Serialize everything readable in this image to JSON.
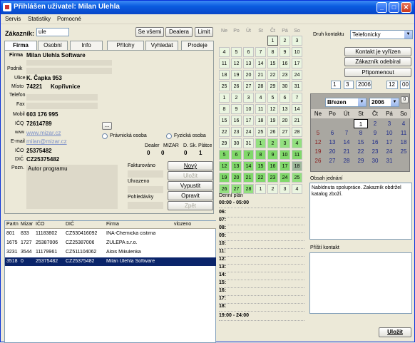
{
  "app": {
    "title": "Přihlášen uživatel: Milan Ulehla",
    "menu": [
      "Servis",
      "Statistiky",
      "Pomocné"
    ]
  },
  "search": {
    "label": "Zákazník:",
    "value": "ule",
    "btn_all": "Se všemi",
    "btn_dealer": "Dealera",
    "btn_limit": "Limit"
  },
  "tabs": [
    "Firma",
    "Osobní",
    "Info",
    "Přílohy",
    "Vyhledat",
    "Prodeje"
  ],
  "company": {
    "firma_label": "Firma",
    "firma": "Milan Ulehla Software",
    "podnik_label": "Podnik",
    "ulice_label": "Ulice",
    "ulice": "K. Čapka 953",
    "misto_label": "Místo",
    "psc": "74221",
    "misto": "Kopřivnice",
    "telefon_label": "Telefon",
    "fax_label": "Fax",
    "mobil_label": "Mobil",
    "mobil": "603 176 995",
    "ico_label": "IČQ",
    "ico": "72614789",
    "www_label": "www",
    "www": "www.mizar.cz",
    "email_label": "E-mail",
    "email": "milan@mizar.cz",
    "ic_label": "IČO",
    "ic": "25375482",
    "dic_label": "DIČ",
    "dic": "CZ25375482",
    "pozn_label": "Pozn.",
    "pozn": "Autor programu",
    "radio_pravnicka": "Právnická osoba",
    "radio_fyzicka": "Fyzická osoba",
    "dealer_label": "Dealer",
    "dealer": "0",
    "mizar_label": "MIZAR",
    "mizar": "0",
    "dsk_label": "D. Sk.",
    "dsk": "0",
    "platce_label": "Plátce",
    "platce": "1",
    "fakturovano": "Fakturováno",
    "uhrazeno": "Uhrazeno",
    "pohledavky": "Pohledávky",
    "btn_novy": "Nový",
    "btn_ulozit": "Uložit",
    "btn_vypustit": "Vypustit",
    "btn_opravit": "Opravit",
    "btn_zpet": "Zpět"
  },
  "table": {
    "headers": [
      "Partn",
      "Mizar",
      "IČO",
      "DIČ",
      "Firma",
      "vlozeno"
    ],
    "rows": [
      [
        "801",
        "833",
        "11183802",
        "CZ530416092",
        "INA-Chemicka cistirna",
        ""
      ],
      [
        "1675",
        "1727",
        "25387006",
        "CZ25387006",
        "ZULEPA s.r.o.",
        ""
      ],
      [
        "3231",
        "3544",
        "11179961",
        "CZ511104062",
        "Alois Mikulenka",
        ""
      ],
      [
        "3518",
        "0",
        "25375482",
        "CZ25375482",
        "Milan Ulehla Software",
        ""
      ]
    ]
  },
  "calendar": {
    "days": [
      "Ne",
      "Po",
      "Út",
      "St",
      "Čt",
      "Pá",
      "So"
    ],
    "rows": [
      [
        "",
        "",
        "",
        "",
        "1",
        "2",
        "3"
      ],
      [
        "4",
        "5",
        "6",
        "7",
        "8",
        "9",
        "10"
      ],
      [
        "11",
        "12",
        "13",
        "14",
        "15",
        "16",
        "17"
      ],
      [
        "18",
        "19",
        "20",
        "21",
        "22",
        "23",
        "24"
      ],
      [
        "25",
        "26",
        "27",
        "28",
        "29",
        "30",
        "31"
      ],
      [
        "1",
        "2",
        "3",
        "4",
        "5",
        "6",
        "7"
      ],
      [
        "8",
        "9",
        "10",
        "11",
        "12",
        "13",
        "14"
      ],
      [
        "15",
        "16",
        "17",
        "18",
        "19",
        "20",
        "21"
      ],
      [
        "22",
        "23",
        "24",
        "25",
        "26",
        "27",
        "28"
      ],
      [
        "29",
        "30",
        "31",
        "1",
        "2",
        "3",
        "4"
      ],
      [
        "5",
        "6",
        "7",
        "8",
        "9",
        "10",
        "11"
      ],
      [
        "12",
        "13",
        "14",
        "15",
        "16",
        "17",
        "18"
      ],
      [
        "19",
        "20",
        "21",
        "22",
        "23",
        "24",
        "25"
      ],
      [
        "26",
        "27",
        "28",
        "1",
        "2",
        "3",
        "4"
      ]
    ]
  },
  "schedule": {
    "title": "Denní plán",
    "start": "00:00 - 05:00",
    "hours": [
      "06:",
      "07:",
      "08:",
      "09:",
      "10:",
      "11:",
      "12:",
      "13:",
      "14:",
      "15:",
      "16:",
      "17:",
      "18:"
    ],
    "end": "19:00 - 24:00"
  },
  "contact": {
    "druh_label": "Druh kontaktu",
    "druh": "Telefonicky",
    "btn_vyrizen": "Kontakt je vyřízen",
    "btn_odebiral": "Zákazník odebíral",
    "btn_pripomenout": "Připomenout",
    "date_d": "1",
    "date_m": "3",
    "date_y": "2006",
    "time_h": "12",
    "time_m": "00",
    "obsah_label": "Obsah jednání",
    "obsah": "Nabídnuta spolupráce. Zakazník obdržel katalog zboží.",
    "pristi_label": "Příští kontakt",
    "btn_ulozit": "Uložit"
  },
  "minical": {
    "month": "Březen",
    "year": "2006",
    "days": [
      "Ne",
      "Po",
      "Út",
      "St",
      "Čt",
      "Pá",
      "So"
    ],
    "rows": [
      [
        "",
        "",
        "",
        "1",
        "2",
        "3",
        "4"
      ],
      [
        "5",
        "6",
        "7",
        "8",
        "9",
        "10",
        "11"
      ],
      [
        "12",
        "13",
        "14",
        "15",
        "16",
        "17",
        "18"
      ],
      [
        "19",
        "20",
        "21",
        "22",
        "23",
        "24",
        "25"
      ],
      [
        "26",
        "27",
        "28",
        "29",
        "30",
        "31",
        ""
      ]
    ]
  }
}
